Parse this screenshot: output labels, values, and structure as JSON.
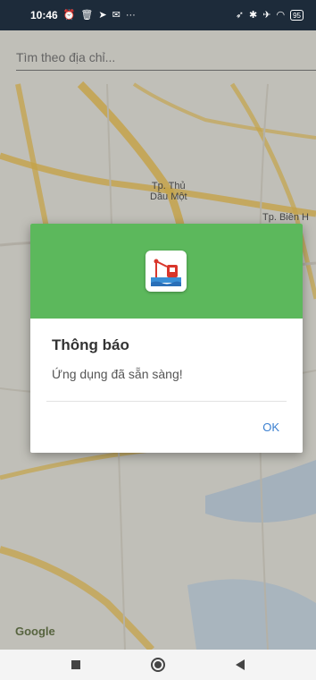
{
  "status_bar": {
    "time": "10:46",
    "left_icons": [
      "alarm-icon",
      "trash-icon",
      "send-icon",
      "mail-icon",
      "more-icon"
    ],
    "right_icons": [
      "location-icon",
      "bluetooth-icon",
      "airplane-icon",
      "wifi-icon"
    ],
    "battery": "95"
  },
  "search": {
    "placeholder": "Tìm theo địa chỉ..."
  },
  "map": {
    "labels": {
      "city1": "Tp. Thủ\nDầu Một",
      "city2": "Tp. Biên H"
    },
    "attribution": "Google"
  },
  "dialog": {
    "header_color": "#5cb85c",
    "title": "Thông báo",
    "message": "Ứng dụng đã sẵn sàng!",
    "ok_label": "OK"
  },
  "nav": {
    "icons": [
      "square-icon",
      "circle-icon",
      "back-triangle-icon"
    ]
  }
}
